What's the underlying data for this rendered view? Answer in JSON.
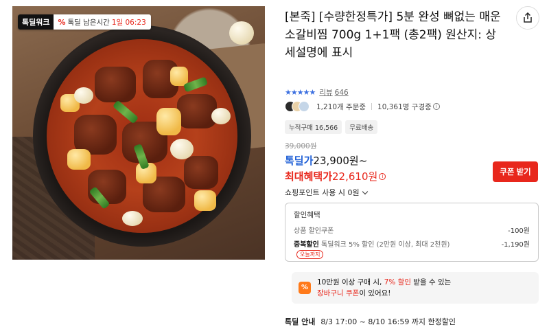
{
  "badge": {
    "brand": "톡딜워크",
    "percent_symbol": "%",
    "label": "톡딜 남은시간",
    "time": "1일 06:23"
  },
  "product": {
    "title": "[본죽] [수량한정특가] 5분 완성 뼈없는 매운 소갈비찜 700g 1+1팩 (총2팩) 원산지: 상세설명에 표시",
    "rating_stars": "★★★★★",
    "review_label": "리뷰",
    "review_count": "646",
    "orders": "1,210개 주문중",
    "viewers": "10,361명 구경중",
    "chips": [
      "누적구매 16,566",
      "무료배송"
    ]
  },
  "pricing": {
    "original_price": "39,000원",
    "deal_label": "톡딜가",
    "deal_price": "23,900원~",
    "best_label": "최대혜택가",
    "best_price": "22,610원",
    "coupon_button": "쿠폰 받기",
    "points_label": "쇼핑포인트 사용 시 0원"
  },
  "discount": {
    "title": "할인혜택",
    "rows": [
      {
        "label": "상품 할인쿠폰",
        "amount": "-100원"
      },
      {
        "label_bold": "중복할인",
        "label": "톡딜워크 5% 할인 (2만원 이상, 최대 2천원)",
        "amount": "-1,190원",
        "tag": "오늘까지"
      }
    ]
  },
  "cart_banner": {
    "icon": "%",
    "line1_a": "10만원 이상 구매 시,",
    "line1_highlight": "7% 할인",
    "line1_b": "받을 수 있는",
    "line2_highlight": "장바구니 쿠폰",
    "line2_b": "이 있어요!"
  },
  "deal_info": {
    "label": "톡딜 안내",
    "text": "8/3 17:00 ~ 8/10 16:59 까지 한정할인"
  },
  "colors": {
    "accent_red": "#e8271c",
    "deal_blue": "#1f5fd6",
    "star_blue": "#3b6fe0"
  }
}
